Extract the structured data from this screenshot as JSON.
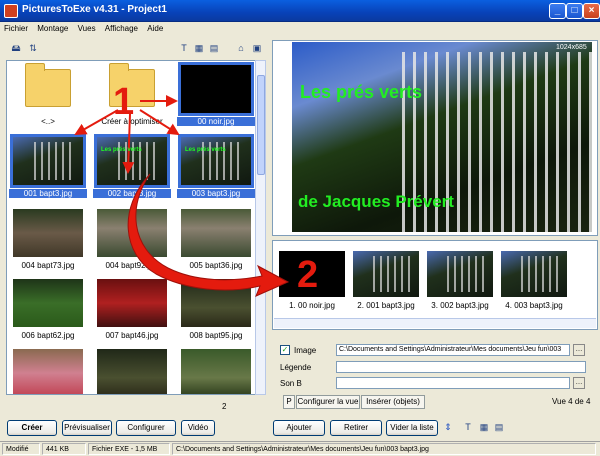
{
  "window": {
    "title": "PicturesToExe v4.31 - Project1"
  },
  "menu": [
    "Fichier",
    "Montage",
    "Vues",
    "Affichage",
    "Aide"
  ],
  "browser": {
    "items": [
      {
        "label": "<..>",
        "kind": "folder"
      },
      {
        "label": "Créer à optimiser",
        "kind": "folder"
      },
      {
        "label": "00 noir.jpg",
        "kind": "black",
        "selected": true
      },
      {
        "label": "001 bapt3.jpg",
        "kind": "gate",
        "selected": true
      },
      {
        "label": "002 bapt3.jpg",
        "kind": "gate",
        "selected": true
      },
      {
        "label": "003 bapt3.jpg",
        "kind": "gate",
        "selected": true
      },
      {
        "label": "004 bapt73.jpg",
        "kind": "bench"
      },
      {
        "label": "004 bapt92.jpg",
        "kind": "statue"
      },
      {
        "label": "005 bapt36.jpg",
        "kind": "statue"
      },
      {
        "label": "006 bapt62.jpg",
        "kind": "green"
      },
      {
        "label": "007 bapt46.jpg",
        "kind": "red"
      },
      {
        "label": "008 bapt95.jpg",
        "kind": "dark"
      },
      {
        "label": "",
        "kind": "pink"
      },
      {
        "label": "",
        "kind": "dark"
      },
      {
        "label": "",
        "kind": "garden"
      }
    ],
    "page_indicator": "2",
    "thumb_overlay": "Les prés verts"
  },
  "preview": {
    "title": "Les prés verts",
    "subtitle": "de Jacques Prévert",
    "resolution": "1024x685"
  },
  "annotations": {
    "one": "1",
    "two": "2"
  },
  "slides": [
    {
      "label": "1. 00 noir.jpg",
      "kind": "black"
    },
    {
      "label": "2. 001 bapt3.jpg",
      "kind": "gate"
    },
    {
      "label": "3. 002 bapt3.jpg",
      "kind": "gate"
    },
    {
      "label": "4. 003 bapt3.jpg",
      "kind": "gate"
    }
  ],
  "properties": {
    "image_label": "Image",
    "image_checked": true,
    "image_path": "C:\\Documents and Settings\\Administrateur\\Mes documents\\Jeu fun\\003",
    "legende_label": "Légende",
    "legende_value": "",
    "son_label": "Son B",
    "son_value": "",
    "tabs": [
      "P",
      "Configurer la vue",
      "Insérer (objets)"
    ],
    "view_counter": "Vue 4 de 4"
  },
  "buttons": {
    "create": "Créer",
    "preview": "Prévisualiser",
    "configure": "Configurer",
    "video": "Vidéo",
    "add": "Ajouter",
    "remove": "Retirer",
    "clear": "Vider la liste"
  },
  "status": {
    "state": "Modifié",
    "size": "441 KB",
    "exe": "Fichier EXE - 1,5 MB",
    "path": "C:\\Documents and Settings\\Administrateur\\Mes documents\\Jeu fun\\003 bapt3.jpg"
  },
  "colors": {
    "accent": "#3a6fd8",
    "title_text": "#22ee22",
    "annotation": "#e41b0e"
  }
}
